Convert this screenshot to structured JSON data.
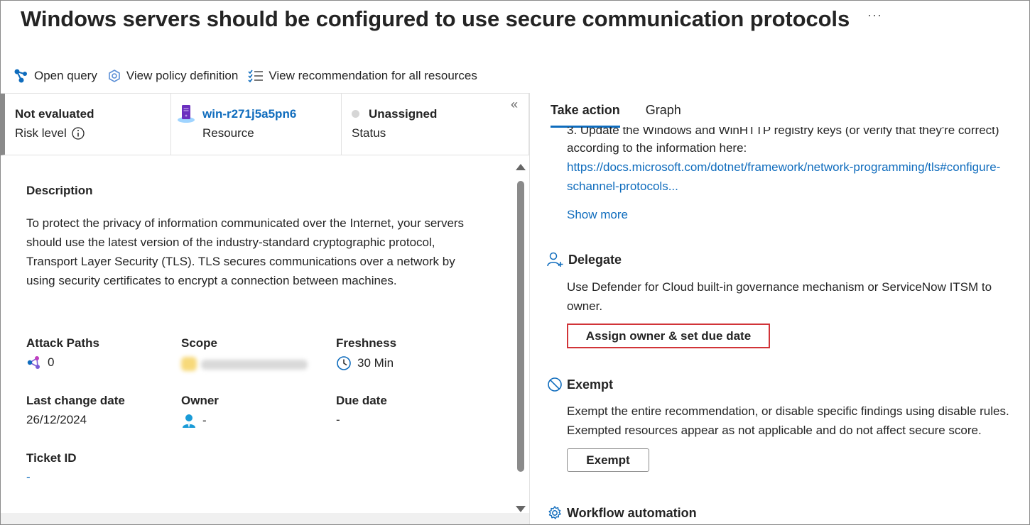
{
  "header": {
    "title": "Windows servers should be configured to use secure communication protocols",
    "more_label": "···"
  },
  "toolbar": {
    "open_query": "Open query",
    "view_policy": "View policy definition",
    "view_all": "View recommendation for all resources"
  },
  "summary": {
    "risk_value": "Not evaluated",
    "risk_label": "Risk level",
    "resource_name": "win-r271j5a5pn6",
    "resource_label": "Resource",
    "status_value": "Unassigned",
    "status_label": "Status"
  },
  "details": {
    "description_heading": "Description",
    "description_text": "To protect the privacy of information communicated over the Internet, your servers should use the latest version of the industry-standard cryptographic protocol, Transport Layer Security (TLS). TLS secures communications over a network by using security certificates to encrypt a connection between machines.",
    "attack_paths_label": "Attack Paths",
    "attack_paths_value": "0",
    "scope_label": "Scope",
    "freshness_label": "Freshness",
    "freshness_value": "30 Min",
    "last_change_label": "Last change date",
    "last_change_value": "26/12/2024",
    "owner_label": "Owner",
    "owner_value": "-",
    "due_date_label": "Due date",
    "due_date_value": "-",
    "ticket_label": "Ticket ID",
    "ticket_value": "-"
  },
  "tabs": [
    {
      "label": "Take action",
      "active": true
    },
    {
      "label": "Graph",
      "active": false
    }
  ],
  "take_action": {
    "step_text_cut": "3. Update the Windows and WinHTTP registry keys (or verify that they're correct)",
    "step_text_2": "according to the information here:",
    "link_line_1": "https://docs.microsoft.com/dotnet/framework/network-programming/tls#configure-",
    "link_line_2": "schannel-protocols...",
    "show_more": "Show more",
    "delegate_heading": "Delegate",
    "delegate_text_1": "Use Defender for Cloud built-in governance mechanism or ServiceNow ITSM to",
    "delegate_text_2": "owner.",
    "assign_button": "Assign owner & set due date",
    "exempt_heading": "Exempt",
    "exempt_text_1": "Exempt the entire recommendation, or disable specific findings using disable rules.",
    "exempt_text_2": "Exempted resources appear as not applicable and do not affect secure score.",
    "exempt_button": "Exempt",
    "workflow_heading": "Workflow automation"
  },
  "colors": {
    "accent": "#0f6cbd",
    "highlight": "#d13438",
    "risk_bar": "#8a8a8a"
  }
}
